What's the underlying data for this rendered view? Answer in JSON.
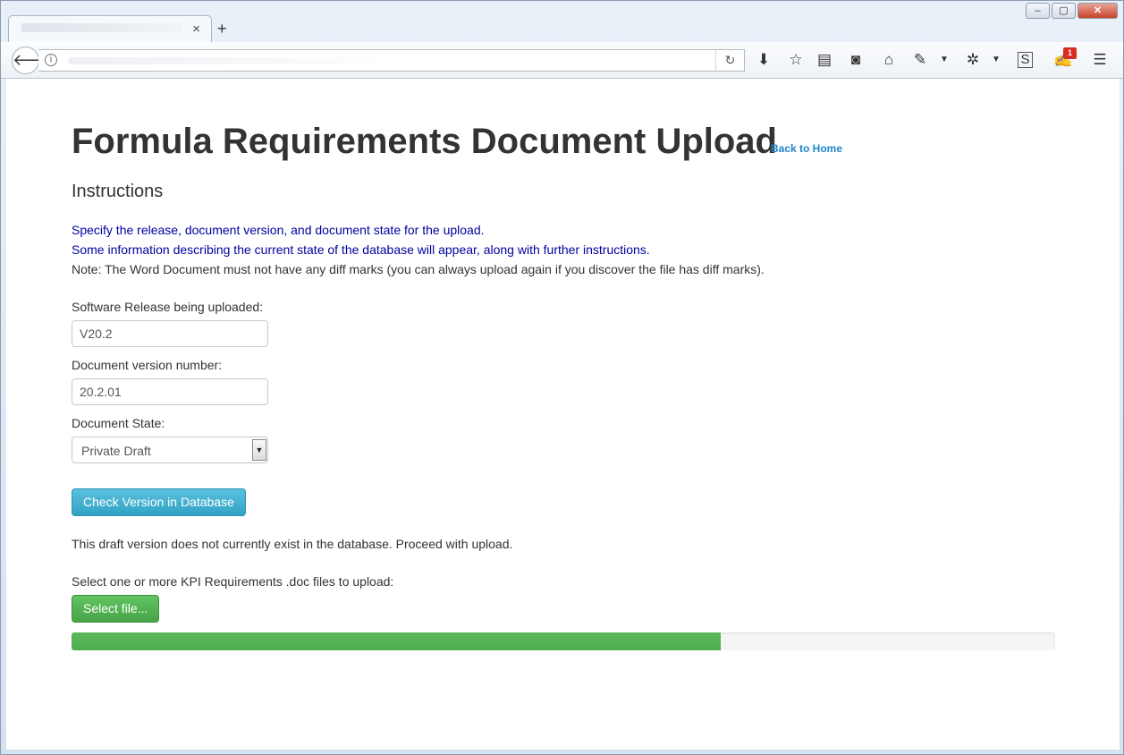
{
  "browser": {
    "tab_close": "×",
    "new_tab": "+",
    "window_controls": {
      "minimize": "‒",
      "maximize": "▢",
      "close": "✕"
    },
    "notification_badge": "1"
  },
  "page": {
    "title": "Formula Requirements Document Upload",
    "back_link": "Back to Home",
    "instructions_heading": "Instructions",
    "instruction_1": "Specify the release, document version, and document state for the upload.",
    "instruction_2": "Some information describing the current state of the database will appear, along with further instructions.",
    "note": "Note: The Word Document must not have any diff marks (you can always upload again if you discover the file has diff marks).",
    "release_label": "Software Release being uploaded:",
    "release_value": "V20.2",
    "version_label": "Document version number:",
    "version_value": "20.2.01",
    "state_label": "Document State:",
    "state_value": "Private Draft",
    "check_button": "Check Version in Database",
    "status_message": "This draft version does not currently exist in the database. Proceed with upload.",
    "file_prompt": "Select one or more KPI Requirements .doc files to upload:",
    "select_file_button": "Select file...",
    "upload_progress": 0.66
  },
  "colors": {
    "link": "#1f86c9",
    "instruction_text": "#0000a0",
    "info_button": "#5bc0de",
    "success_button": "#5cb85c"
  }
}
